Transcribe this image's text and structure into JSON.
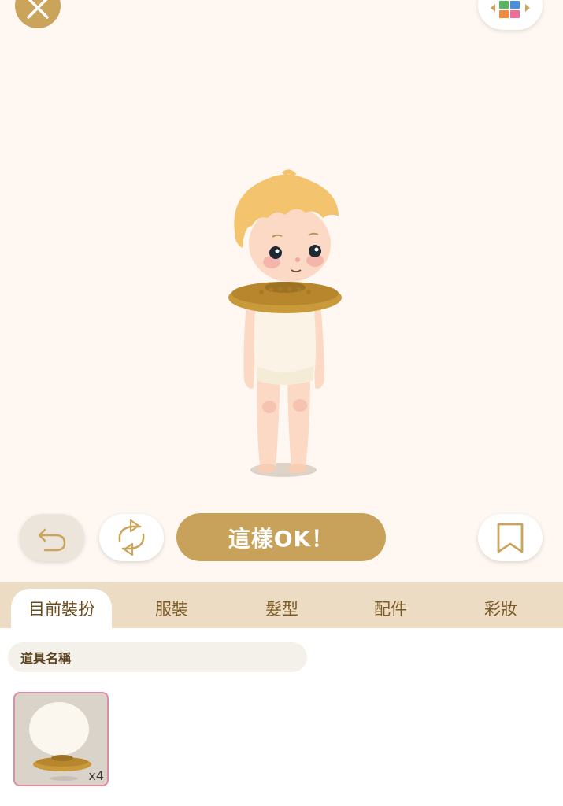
{
  "toolbar": {
    "close_icon": "close-icon",
    "layout_icon": "color-grid-icon"
  },
  "controls": {
    "undo_icon": "undo-icon",
    "rotate_icon": "rotate-icon",
    "ok_label": "這樣OK！",
    "bookmark_icon": "bookmark-icon"
  },
  "tabs": [
    {
      "label": "目前裝扮",
      "active": true
    },
    {
      "label": "服裝",
      "active": false
    },
    {
      "label": "髮型",
      "active": false
    },
    {
      "label": "配件",
      "active": false
    },
    {
      "label": "彩妝",
      "active": false
    }
  ],
  "panel": {
    "item_name_label": "道具名稱",
    "items": [
      {
        "count": "x4",
        "selected": true
      }
    ]
  },
  "colors": {
    "accent": "#c8a25a",
    "background": "#fff8f2",
    "tab_bar": "#ecdcc3",
    "selected_border": "#e58ba0"
  }
}
